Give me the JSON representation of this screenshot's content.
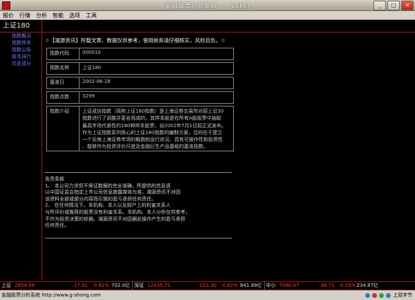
{
  "window": {
    "title": "金融股票分析系统",
    "brand": "veket"
  },
  "menu": [
    "报价",
    "行情",
    "分析",
    "智能",
    "选项",
    "工具"
  ],
  "sidebar": {
    "title": "上证180",
    "items": [
      "指数概况",
      "指数样本",
      "指数公告",
      "股本排行",
      "历史成分"
    ]
  },
  "notice": "☆【湘源资讯】所载文章、数据仅供参考，使用前务请仔细核实，风险自负。☆",
  "info": {
    "rows": [
      {
        "label": "指数代码",
        "value": "000010"
      },
      {
        "label": "指数名称",
        "value": "上证180"
      },
      {
        "label": "基准日",
        "value": "2002-06-28"
      },
      {
        "label": "指数点数",
        "value": "3299"
      }
    ],
    "desc_label": "指数介绍",
    "desc_lines": [
      "上证成份指数（简称上证180指数）是上海证券交易所对原上证30",
      "指数进行了调整并更名而成的，其样本股是在所有A股股票中抽取",
      "最具市场代表性的180种样本股票，自2002年7月1日起正式发布。",
      "作为上证指数系列核心的上证180指数的编制方案，目的在于建立",
      "一个反映上海证券市场的概貌和运行状况、具有可操作性和投资性",
      "、能够作为投资评价尺度及金融衍生产品基础的基准指数。"
    ]
  },
  "disclaimer": {
    "title": "免责条款",
    "lines": [
      "1、 本公司力求但不保证数据的完全准确，所提供的信息请",
      "     以中国证监会指定上市公司信息披露媒体为准，湘源资讯不对因",
      "     该资料全部或部分内容而引致的盈亏承担任何责任。",
      "2、 在任何情况下，本机构、本人以及财产上的利害关系人",
      "     与所评价或推荐的股票没有利害关系。本机构、本人分析仅供参考，",
      "     不作为投资决策的依据。湘源资讯不对因据此操作产生的盈亏承担",
      "     任何责任。"
    ]
  },
  "ticker": [
    {
      "name": "上证",
      "values": [
        "2854.09",
        "-17.01",
        "-0.61%",
        "702.0亿"
      ]
    },
    {
      "name": "深证",
      "values": [
        "12435.71",
        "-103.30",
        "-0.82%",
        "841.99亿"
      ]
    },
    {
      "name": "中小",
      "values": [
        "7060.07",
        "-38.71",
        "-0.55%",
        "234.87亿"
      ]
    }
  ],
  "status": {
    "left": "金融股票分析系统 http://www.g-shong.com",
    "right": "上双字节"
  },
  "colors": {
    "accent": "#b01818",
    "link": "#7878ff",
    "down": "#ff4040"
  }
}
